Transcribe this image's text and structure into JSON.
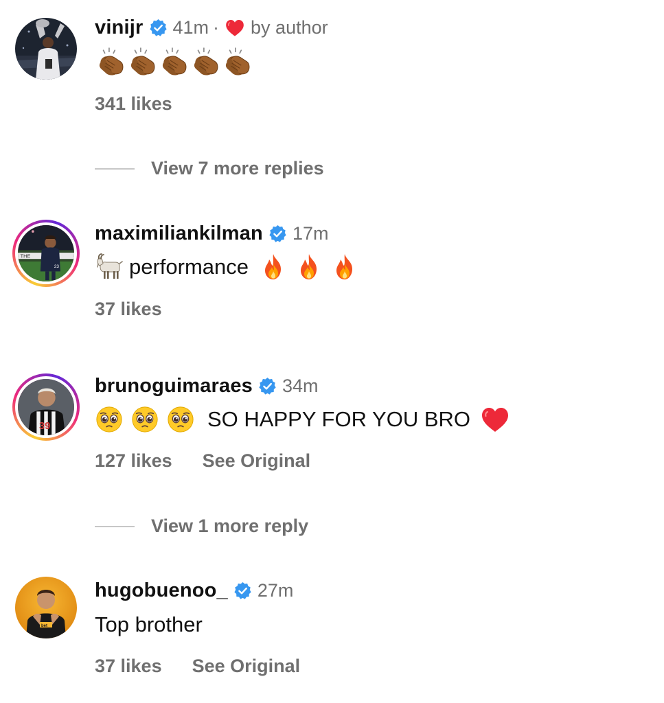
{
  "comments": [
    {
      "username": "vinijr",
      "time": "41m",
      "separator": "·",
      "author_like": "by author",
      "text": "",
      "emojis": [
        "clapping-hands",
        "clapping-hands",
        "clapping-hands",
        "clapping-hands",
        "clapping-hands"
      ],
      "likes": "341 likes",
      "replies_link": "View 7 more replies"
    },
    {
      "username": "maximiliankilman",
      "time": "17m",
      "text": "performance",
      "likes": "37 likes"
    },
    {
      "username": "brunoguimaraes",
      "time": "34m",
      "text": "SO HAPPY FOR YOU BRO",
      "likes": "127 likes",
      "see_original": "See Original",
      "replies_link": "View 1 more reply"
    },
    {
      "username": "hugobuenoo_",
      "time": "27m",
      "text": "Top brother",
      "likes": "37 likes",
      "see_original": "See Original"
    }
  ],
  "icons": {
    "verified": "verified-badge-icon",
    "heart": "red-heart-icon",
    "clap": "clapping-hands-emoji",
    "goat": "goat-emoji",
    "fire": "fire-emoji",
    "pleading": "pleading-face-emoji",
    "red_heart_emoji": "red-heart-emoji"
  },
  "colors": {
    "verified_blue": "#3797f0",
    "heart_red": "#ed2939",
    "secondary_text": "#6f6f6f",
    "primary_text": "#111111"
  }
}
